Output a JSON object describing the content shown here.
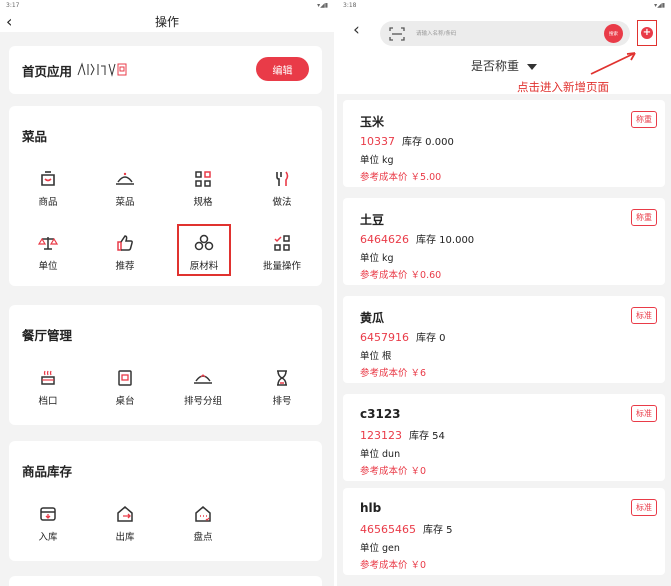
{
  "left": {
    "status_time": "3:17",
    "title": "操作",
    "home_card": {
      "label": "首页应用",
      "edit_label": "编辑"
    },
    "sections": [
      {
        "title": "菜品",
        "items": [
          {
            "label": "商品",
            "icon": "bag-icon"
          },
          {
            "label": "菜品",
            "icon": "dish-cover-icon"
          },
          {
            "label": "规格",
            "icon": "grid-icon"
          },
          {
            "label": "做法",
            "icon": "utensils-icon"
          },
          {
            "label": "单位",
            "icon": "scale-icon"
          },
          {
            "label": "推荐",
            "icon": "thumbs-up-icon"
          },
          {
            "label": "原材料",
            "icon": "ingredients-icon"
          },
          {
            "label": "批量操作",
            "icon": "batch-icon"
          }
        ]
      },
      {
        "title": "餐厅管理",
        "items": [
          {
            "label": "档口",
            "icon": "stall-icon"
          },
          {
            "label": "桌台",
            "icon": "table-icon"
          },
          {
            "label": "排号分组",
            "icon": "queue-group-icon"
          },
          {
            "label": "排号",
            "icon": "hourglass-icon"
          }
        ]
      },
      {
        "title": "商品库存",
        "items": [
          {
            "label": "入库",
            "icon": "inbound-icon"
          },
          {
            "label": "出库",
            "icon": "outbound-icon"
          },
          {
            "label": "盘点",
            "icon": "inventory-icon"
          }
        ]
      }
    ]
  },
  "right": {
    "status_time": "3:18",
    "search_placeholder": "请输入名称/条码",
    "search_button": "搜索",
    "filter_label": "是否称重",
    "annotation": "点击进入新增页面",
    "items": [
      {
        "name": "玉米",
        "code": "10337",
        "stock": "库存 0.000",
        "unit": "单位  kg",
        "cost": "参考成本价 ￥5.00",
        "tag": "称重"
      },
      {
        "name": "土豆",
        "code": "6464626",
        "stock": "库存 10.000",
        "unit": "单位  kg",
        "cost": "参考成本价 ￥0.60",
        "tag": "称重"
      },
      {
        "name": "黄瓜",
        "code": "6457916",
        "stock": "库存 0",
        "unit": "单位  根",
        "cost": "参考成本价 ￥6",
        "tag": "标准"
      },
      {
        "name": "c3123",
        "code": "123123",
        "stock": "库存 54",
        "unit": "单位  dun",
        "cost": "参考成本价 ￥0",
        "tag": "标准"
      },
      {
        "name": "hlb",
        "code": "46565465",
        "stock": "库存 5",
        "unit": "单位  gen",
        "cost": "参考成本价 ￥0",
        "tag": "标准"
      }
    ]
  },
  "colors": {
    "accent": "#e93b48",
    "annotation": "#e0322f"
  }
}
